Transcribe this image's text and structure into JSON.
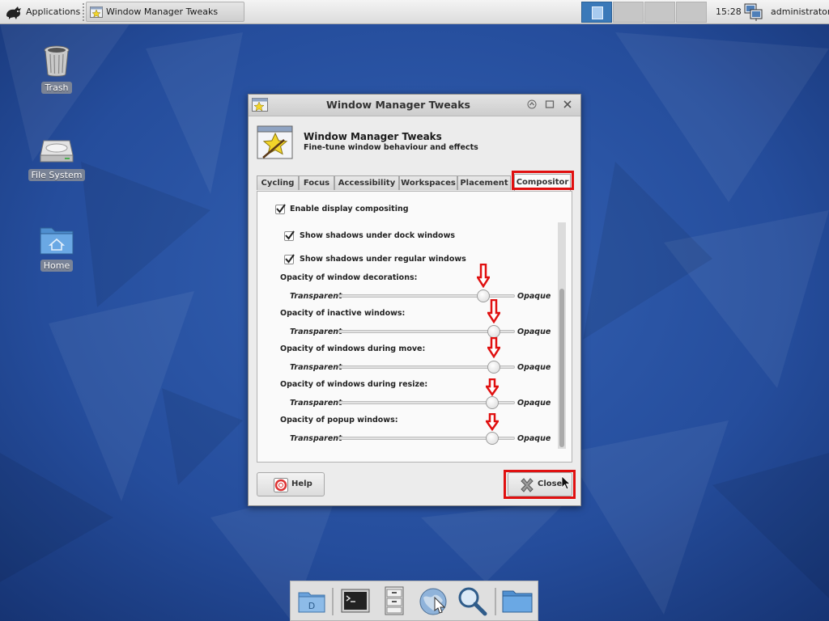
{
  "top_panel": {
    "applications_label": "Applications",
    "task_label": "Window Manager Tweaks",
    "workspaces": [
      "1",
      "2",
      "3",
      "4"
    ],
    "clock": "15:28",
    "user": "administrator"
  },
  "desktop": {
    "icons": [
      {
        "label": "Trash",
        "icon": "trash-icon"
      },
      {
        "label": "File System",
        "icon": "drive-icon"
      },
      {
        "label": "Home",
        "icon": "home-folder-icon"
      }
    ]
  },
  "dialog": {
    "title": "Window Manager Tweaks",
    "header_title": "Window Manager Tweaks",
    "header_subtitle": "Fine-tune window behaviour and effects",
    "tabs": [
      {
        "label": "Cycling",
        "active": false
      },
      {
        "label": "Focus",
        "active": false
      },
      {
        "label": "Accessibility",
        "active": false
      },
      {
        "label": "Workspaces",
        "active": false
      },
      {
        "label": "Placement",
        "active": false
      },
      {
        "label": "Compositor",
        "active": true
      }
    ],
    "compositor": {
      "enable_compositing": {
        "label": "Enable display compositing",
        "checked": true
      },
      "shadows_dock": {
        "label": "Show shadows under dock windows",
        "checked": true
      },
      "shadows_regular": {
        "label": "Show shadows under regular windows",
        "checked": true
      },
      "sliders": [
        {
          "label": "Opacity of window decorations:",
          "min_label": "Transparent",
          "max_label": "Opaque",
          "value_pct": 82
        },
        {
          "label": "Opacity of inactive windows:",
          "min_label": "Transparent",
          "max_label": "Opaque",
          "value_pct": 88
        },
        {
          "label": "Opacity of windows during move:",
          "min_label": "Transparent",
          "max_label": "Opaque",
          "value_pct": 88
        },
        {
          "label": "Opacity of windows during resize:",
          "min_label": "Transparent",
          "max_label": "Opaque",
          "value_pct": 87
        },
        {
          "label": "Opacity of popup windows:",
          "min_label": "Transparent",
          "max_label": "Opaque",
          "value_pct": 87
        }
      ]
    },
    "help_label": "Help",
    "close_label": "Close"
  },
  "dock": {
    "items": [
      "show-desktop-icon",
      "terminal-icon",
      "file-cabinet-icon",
      "web-browser-icon",
      "search-icon",
      "folder-icon"
    ]
  },
  "colors": {
    "accent": "#3a79b9",
    "highlight": "#e01010",
    "wallpaper": "#1e3f86"
  }
}
